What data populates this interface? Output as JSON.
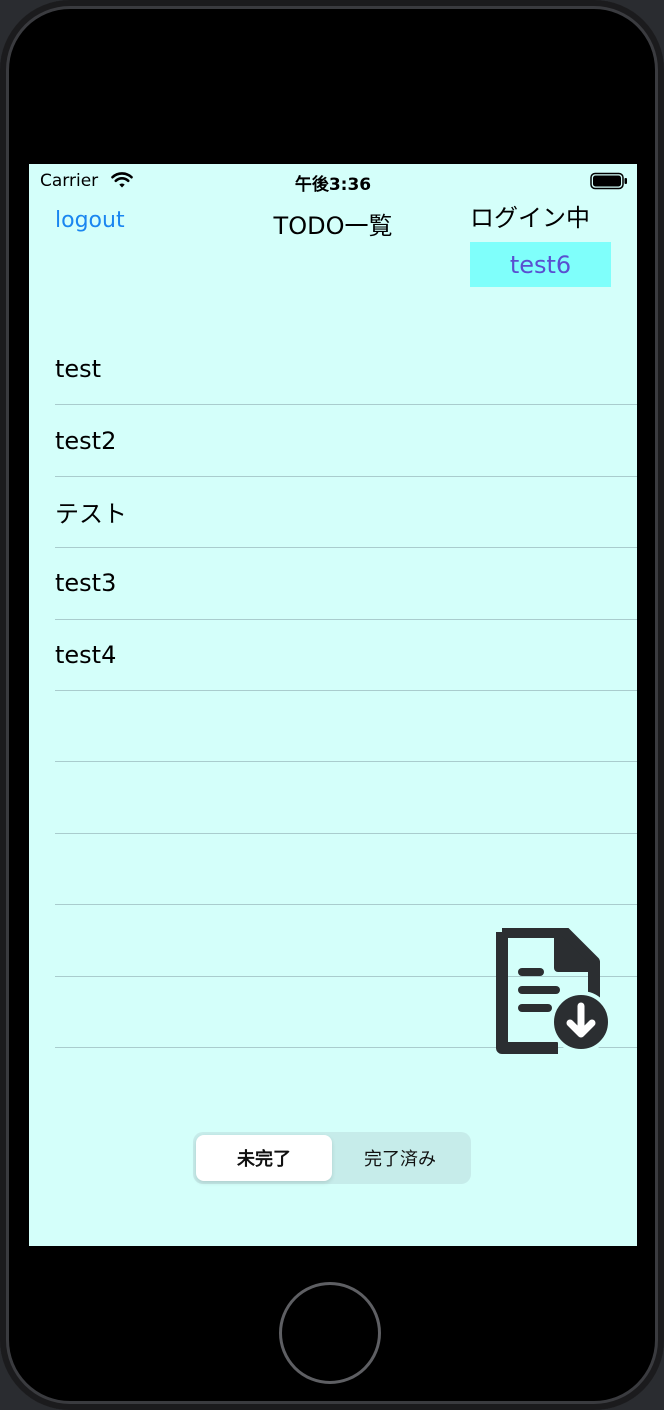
{
  "status_bar": {
    "carrier": "Carrier",
    "time": "午後3:36",
    "wifi_icon": "wifi-icon",
    "battery_icon": "battery-icon"
  },
  "nav": {
    "logout_label": "logout",
    "title": "TODO一覧",
    "login_status_label": "ログイン中",
    "username": "test6"
  },
  "todos": [
    {
      "label": "test"
    },
    {
      "label": "test2"
    },
    {
      "label": "テスト"
    },
    {
      "label": "test3"
    },
    {
      "label": "test4"
    },
    {
      "label": ""
    },
    {
      "label": ""
    },
    {
      "label": ""
    },
    {
      "label": ""
    },
    {
      "label": ""
    }
  ],
  "download_button": {
    "icon": "document-download-icon"
  },
  "segments": {
    "selected_index": 0,
    "items": [
      "未完了",
      "完了済み"
    ]
  },
  "colors": {
    "background": "#d4fffa",
    "link": "#1a86f0",
    "badge_bg": "#7ffffb",
    "badge_text": "#5a4fd0"
  }
}
